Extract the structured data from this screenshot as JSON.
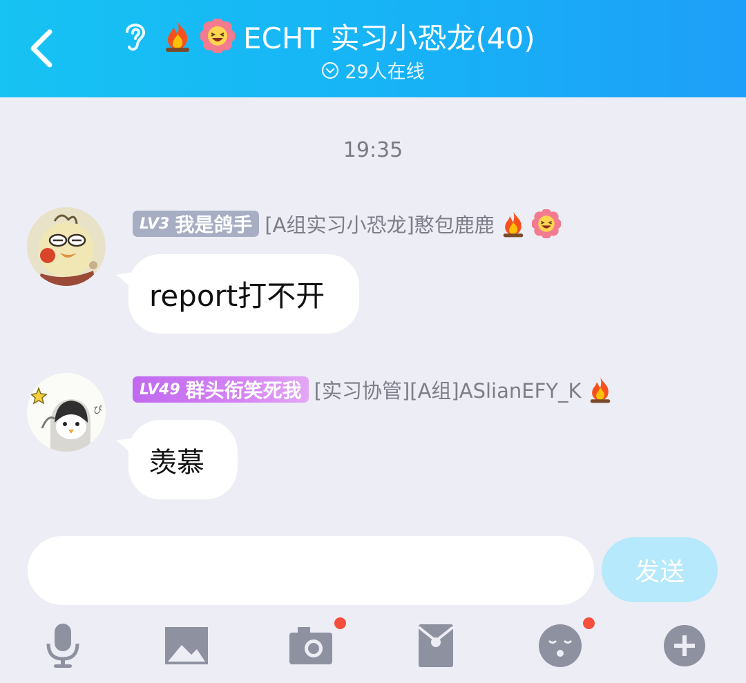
{
  "header": {
    "title": "ECHT 实习小恐龙(40)",
    "online": "29人在线",
    "colors": {
      "gradient_start": "#17c3f3",
      "gradient_end": "#1e9ff9"
    },
    "icons": [
      "back-arrow-icon",
      "ear-icon",
      "fire-emoji",
      "laughing-flower-emoji",
      "chevron-circle-icon"
    ]
  },
  "chat": {
    "timestamp": "19:35",
    "messages": [
      {
        "level": "LV3",
        "badge_title": "我是鸽手",
        "sender": "[A组实习小恐龙]憨包鹿鹿",
        "text": "report打不开",
        "badge_color": "#a7aec3"
      },
      {
        "level": "LV49",
        "badge_title": "群头衔笑死我",
        "sender": "[实习协管][A组]ASlianEFY_K",
        "text": "羡慕",
        "badge_color": "#c069f0"
      }
    ]
  },
  "input": {
    "placeholder": "",
    "value": "",
    "send_label": "发送",
    "send_color": "#b5e9fb"
  },
  "toolbar": {
    "icons": [
      "microphone-icon",
      "image-icon",
      "camera-icon",
      "red-packet-icon",
      "emoji-face-icon",
      "plus-icon"
    ],
    "notification_dots": [
      "camera-icon",
      "emoji-face-icon"
    ]
  }
}
